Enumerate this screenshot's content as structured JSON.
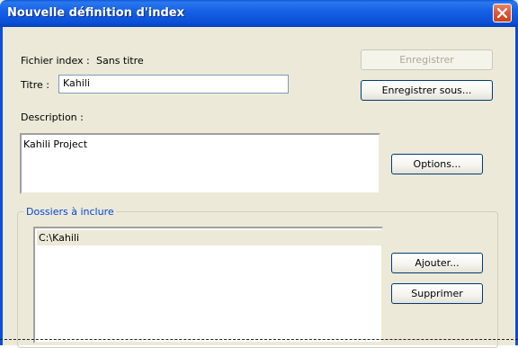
{
  "window": {
    "title": "Nouvelle définition d'index"
  },
  "icons": {
    "close": "close-x-icon"
  },
  "colors": {
    "titlebar": "#0a4fd6",
    "group_legend": "#0046d5",
    "background": "#ece9d8"
  },
  "form": {
    "index_file_label": "Fichier index :",
    "index_file_value": "Sans titre",
    "title_label": "Titre :",
    "title_value": "Kahili",
    "description_label": "Description :",
    "description_value": "Kahili Project"
  },
  "buttons": {
    "save": "Enregistrer",
    "save_as": "Enregistrer sous...",
    "options": "Options...",
    "add": "Ajouter...",
    "remove": "Supprimer"
  },
  "folders": {
    "legend": "Dossiers à inclure",
    "items": [
      "C:\\Kahili"
    ]
  }
}
